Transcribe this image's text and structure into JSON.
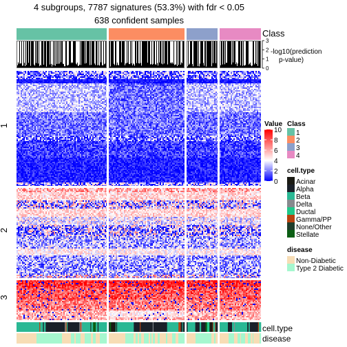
{
  "chart_data": {
    "type": "heatmap",
    "title": "4 subgroups, 7787 signatures (53.3%) with fdr < 0.05",
    "subtitle": "638 confident samples",
    "n_signatures": 7787,
    "signature_percent": 53.3,
    "fdr_threshold": 0.05,
    "confident_samples": 638,
    "column_groups": [
      {
        "class": "1",
        "color": "#66C2A5",
        "relative_width": 131
      },
      {
        "class": "2",
        "color": "#FC8D62",
        "relative_width": 110
      },
      {
        "class": "3",
        "color": "#8DA0CB",
        "relative_width": 45
      },
      {
        "class": "4",
        "color": "#E78AC3",
        "relative_width": 60
      }
    ],
    "row_groups": [
      {
        "label": "1",
        "pattern": "mostly low (blue) with lighter band near top; red-speckled stripes at top and bottom",
        "relative_height": 167
      },
      {
        "label": "2",
        "pattern": "alternating bands of pale red/white and blue with red speckles",
        "relative_height": 131
      },
      {
        "label": "3",
        "pattern": "mostly high (red) fading to pale at bottom with blue speckles in upper rows",
        "relative_height": 57
      }
    ],
    "top_annotation": {
      "class_label": "Class",
      "prediction_label_line1": "-log10(prediction",
      "prediction_label_line2": "p-value)",
      "prediction_axis_ticks": [
        "0",
        "1",
        "2",
        "3"
      ],
      "prediction_axis_range": [
        0,
        3
      ]
    },
    "bottom_annotation": {
      "celltype_label": "cell.type",
      "disease_label": "disease"
    },
    "value_legend": {
      "title": "Value",
      "ticks": [
        "0",
        "2",
        "4",
        "6",
        "8",
        "10"
      ],
      "range": [
        0,
        10
      ],
      "colors": {
        "low": "#0000FF",
        "mid": "#FFFFFF",
        "high": "#FF0000"
      },
      "midpoint": 4
    },
    "class_legend": {
      "title": "Class",
      "items": [
        {
          "label": "1",
          "color": "#66C2A5"
        },
        {
          "label": "2",
          "color": "#FC8D62"
        },
        {
          "label": "3",
          "color": "#8DA0CB"
        },
        {
          "label": "4",
          "color": "#E78AC3"
        }
      ]
    },
    "celltype_legend": {
      "title": "cell.type",
      "items": [
        {
          "label": "Acinar",
          "color": "#1B1B14"
        },
        {
          "label": "Alpha",
          "color": "#1A2029"
        },
        {
          "label": "Beta",
          "color": "#2AB894"
        },
        {
          "label": "Delta",
          "color": "#868A8E"
        },
        {
          "label": "Ductal",
          "color": "#1FC88A"
        },
        {
          "label": "Gamma/PP",
          "color": "#B8420F"
        },
        {
          "label": "None/Other",
          "color": "#1F3D2B"
        },
        {
          "label": "Stellate",
          "color": "#0B5E14"
        }
      ]
    },
    "disease_legend": {
      "title": "disease",
      "items": [
        {
          "label": "Non-Diabetic",
          "color": "#F7DDB5"
        },
        {
          "label": "Type 2 Diabetic",
          "color": "#A6F7CF"
        }
      ]
    },
    "row_split_labels": [
      "1",
      "2",
      "3"
    ]
  }
}
